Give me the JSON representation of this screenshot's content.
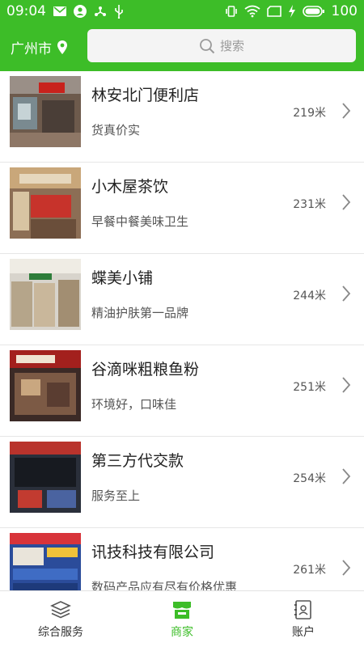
{
  "status_bar": {
    "time": "09:04",
    "battery": "100",
    "left_icons": [
      "mail-icon",
      "account-icon",
      "usb-share-icon",
      "usb-icon"
    ],
    "right_icons": [
      "vibrate-icon",
      "wifi-icon",
      "sim-icon",
      "charging-icon",
      "battery-icon"
    ]
  },
  "header": {
    "city": "广州市",
    "search_placeholder": "搜索"
  },
  "stores": [
    {
      "name": "林安北门便利店",
      "desc": "货真价实",
      "distance": "219米"
    },
    {
      "name": "小木屋茶饮",
      "desc": "早餐中餐美味卫生",
      "distance": "231米"
    },
    {
      "name": "蝶美小铺",
      "desc": "精油护肤第一品牌",
      "distance": "244米"
    },
    {
      "name": "谷滴咪粗粮鱼粉",
      "desc": "环境好，口味佳",
      "distance": "251米"
    },
    {
      "name": "第三方代交款",
      "desc": "服务至上",
      "distance": "254米"
    },
    {
      "name": "讯技科技有限公司",
      "desc": "数码产品应有尽有价格优惠",
      "distance": "261米"
    }
  ],
  "tabs": [
    {
      "label": "综合服务",
      "icon": "layers-icon"
    },
    {
      "label": "商家",
      "icon": "store-icon"
    },
    {
      "label": "账户",
      "icon": "contacts-icon"
    }
  ],
  "colors": {
    "primary": "#3dbd28",
    "background": "#ffffff"
  }
}
